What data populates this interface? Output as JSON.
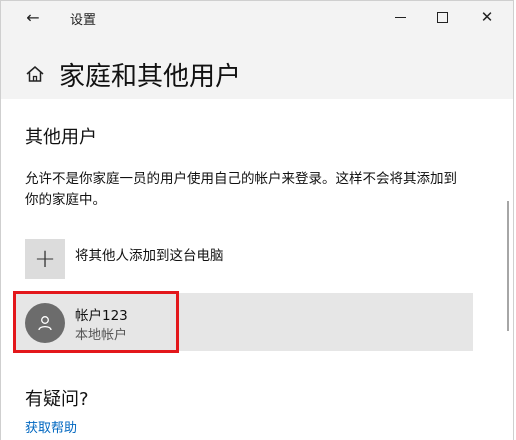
{
  "titlebar": {
    "title": "设置",
    "back_glyph": "←",
    "close_glyph": "✕"
  },
  "header": {
    "page_title": "家庭和其他用户",
    "icon": "home-icon"
  },
  "other_users": {
    "heading": "其他用户",
    "description": "允许不是你家庭一员的用户使用自己的帐户来登录。这样不会将其添加到你的家庭中。",
    "add_label": "将其他人添加到这台电脑",
    "add_glyph": "+"
  },
  "account": {
    "name": "帐户123",
    "type": "本地帐户",
    "icon": "user-icon"
  },
  "help": {
    "heading": "有疑问?",
    "link": "获取帮助"
  },
  "colors": {
    "highlight": "#e3171b",
    "link": "#0067c0",
    "avatar": "#6c6c6c"
  }
}
